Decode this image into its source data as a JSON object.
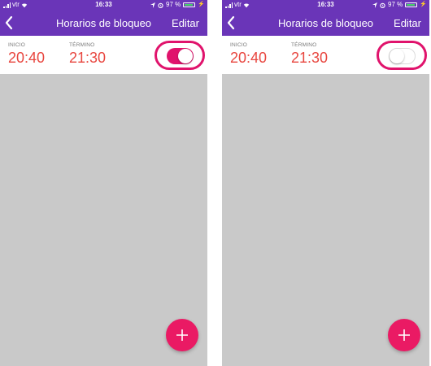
{
  "colors": {
    "header": "#6a35b8",
    "accent": "#e0136c",
    "time_text": "#e8463f",
    "body_bg": "#c9c9c9",
    "battery": "#46d36a"
  },
  "screens": [
    {
      "status": {
        "carrier": "vtr",
        "time": "16:33",
        "battery": "97 %"
      },
      "nav": {
        "back_icon": "chevron-left-icon",
        "title": "Horarios de bloqueo",
        "edit_label": "Editar"
      },
      "schedule": {
        "start_label": "INICIO",
        "start_time": "20:40",
        "end_label": "TÉRMINO",
        "end_time": "21:30",
        "enabled": true
      },
      "fab_icon": "plus-icon"
    },
    {
      "status": {
        "carrier": "vtr",
        "time": "16:33",
        "battery": "97 %"
      },
      "nav": {
        "back_icon": "chevron-left-icon",
        "title": "Horarios de bloqueo",
        "edit_label": "Editar"
      },
      "schedule": {
        "start_label": "INICIO",
        "start_time": "20:40",
        "end_label": "TÉRMINO",
        "end_time": "21:30",
        "enabled": false
      },
      "fab_icon": "plus-icon"
    }
  ]
}
